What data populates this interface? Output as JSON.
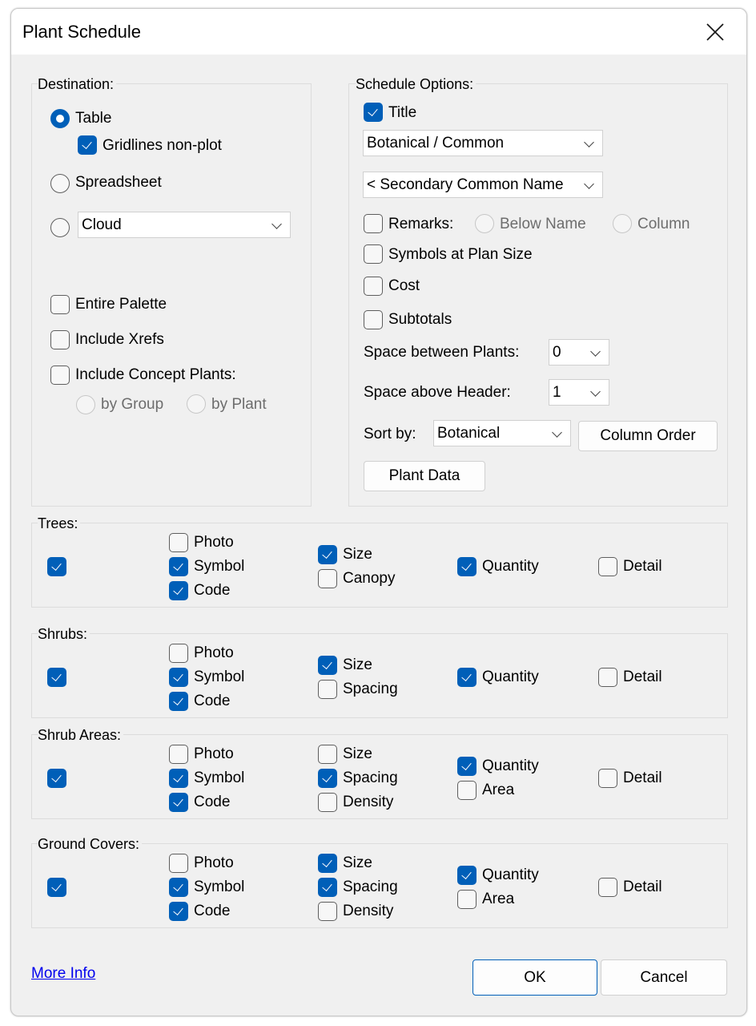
{
  "window": {
    "title": "Plant Schedule",
    "close_icon": "close-icon"
  },
  "destination": {
    "label": "Destination:",
    "table_label": "Table",
    "table_selected": true,
    "gridlines_label": "Gridlines non-plot",
    "gridlines_checked": true,
    "spreadsheet_label": "Spreadsheet",
    "spreadsheet_selected": false,
    "cloud_selected": false,
    "cloud_value": "Cloud",
    "entire_palette_label": "Entire Palette",
    "entire_palette_checked": false,
    "include_xrefs_label": "Include Xrefs",
    "include_xrefs_checked": false,
    "include_concept_label": "Include Concept Plants:",
    "include_concept_checked": false,
    "by_group_label": "by Group",
    "by_plant_label": "by Plant"
  },
  "schedule_options": {
    "label": "Schedule Options:",
    "title_label": "Title",
    "title_checked": true,
    "name_format_value": "Botanical / Common",
    "secondary_value": "< Secondary Common Name",
    "remarks_label": "Remarks:",
    "remarks_checked": false,
    "below_name_label": "Below Name",
    "column_label": "Column",
    "symbols_plan_size_label": "Symbols at Plan Size",
    "symbols_plan_size_checked": false,
    "cost_label": "Cost",
    "cost_checked": false,
    "subtotals_label": "Subtotals",
    "subtotals_checked": false,
    "space_between_label": "Space between Plants:",
    "space_between_value": "0",
    "space_above_label": "Space above Header:",
    "space_above_value": "1",
    "sort_by_label": "Sort by:",
    "sort_by_value": "Botanical",
    "column_order_button": "Column Order",
    "plant_data_button": "Plant Data"
  },
  "categories": [
    {
      "label": "Trees:",
      "enabled": true,
      "col1": [
        {
          "label": "Photo",
          "checked": false
        },
        {
          "label": "Symbol",
          "checked": true
        },
        {
          "label": "Code",
          "checked": true
        }
      ],
      "col2": [
        {
          "label": "Size",
          "checked": true
        },
        {
          "label": "Canopy",
          "checked": false
        }
      ],
      "col3": [
        {
          "label": "Quantity",
          "checked": true
        }
      ],
      "col4": [
        {
          "label": "Detail",
          "checked": false
        }
      ]
    },
    {
      "label": "Shrubs:",
      "enabled": true,
      "col1": [
        {
          "label": "Photo",
          "checked": false
        },
        {
          "label": "Symbol",
          "checked": true
        },
        {
          "label": "Code",
          "checked": true
        }
      ],
      "col2": [
        {
          "label": "Size",
          "checked": true
        },
        {
          "label": "Spacing",
          "checked": false
        }
      ],
      "col3": [
        {
          "label": "Quantity",
          "checked": true
        }
      ],
      "col4": [
        {
          "label": "Detail",
          "checked": false
        }
      ]
    },
    {
      "label": "Shrub Areas:",
      "enabled": true,
      "col1": [
        {
          "label": "Photo",
          "checked": false
        },
        {
          "label": "Symbol",
          "checked": true
        },
        {
          "label": "Code",
          "checked": true
        }
      ],
      "col2": [
        {
          "label": "Size",
          "checked": false
        },
        {
          "label": "Spacing",
          "checked": true
        },
        {
          "label": "Density",
          "checked": false
        }
      ],
      "col3": [
        {
          "label": "Quantity",
          "checked": true
        },
        {
          "label": "Area",
          "checked": false
        }
      ],
      "col4": [
        {
          "label": "Detail",
          "checked": false
        }
      ]
    },
    {
      "label": "Ground Covers:",
      "enabled": true,
      "col1": [
        {
          "label": "Photo",
          "checked": false
        },
        {
          "label": "Symbol",
          "checked": true
        },
        {
          "label": "Code",
          "checked": true
        }
      ],
      "col2": [
        {
          "label": "Size",
          "checked": true
        },
        {
          "label": "Spacing",
          "checked": true
        },
        {
          "label": "Density",
          "checked": false
        }
      ],
      "col3": [
        {
          "label": "Quantity",
          "checked": true
        },
        {
          "label": "Area",
          "checked": false
        }
      ],
      "col4": [
        {
          "label": "Detail",
          "checked": false
        }
      ]
    }
  ],
  "footer": {
    "more_info_link": "More Info",
    "ok_button": "OK",
    "cancel_button": "Cancel"
  },
  "colors": {
    "accent": "#005fb8",
    "link": "#0000ee",
    "dialog_bg": "#f0f0f0"
  }
}
